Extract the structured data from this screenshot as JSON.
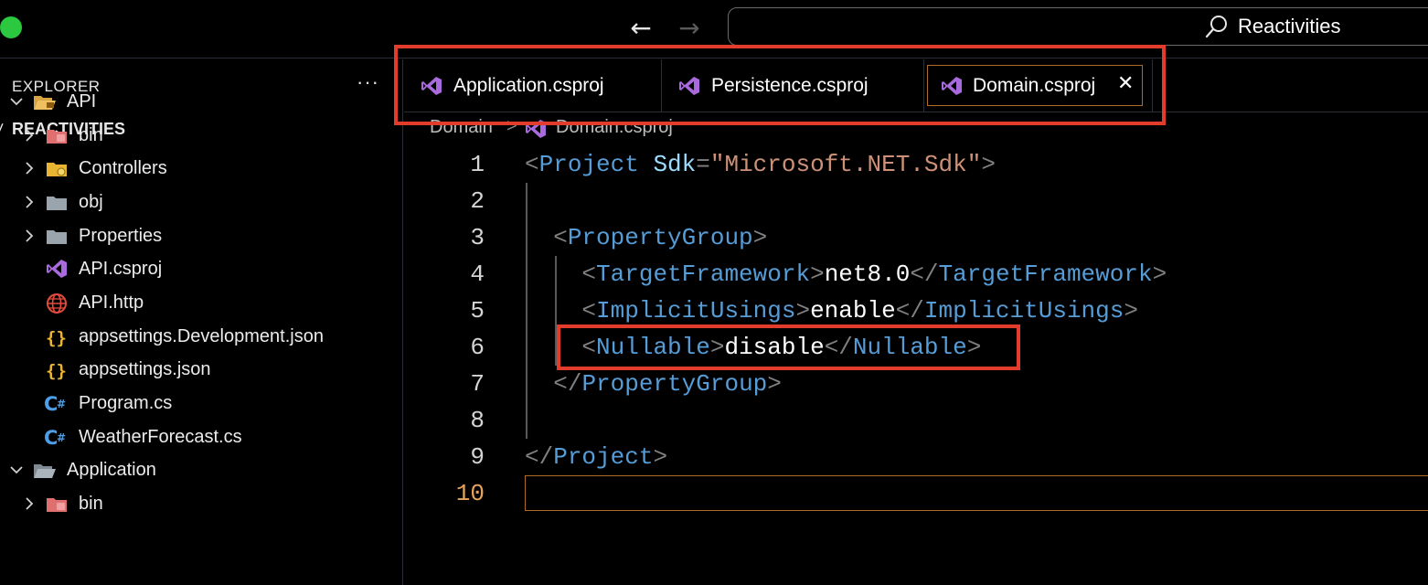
{
  "titlebar": {
    "back_icon": "arrow-left",
    "forward_icon": "arrow-right",
    "search_icon": "search-icon",
    "command_center_label": "Reactivities"
  },
  "sidebar": {
    "title": "EXPLORER",
    "more_label": "···",
    "workspace": "REACTIVITIES",
    "tree": [
      {
        "label": "API",
        "icon": "folder-api-open",
        "expanded": true
      },
      {
        "label": "bin",
        "icon": "folder-bin"
      },
      {
        "label": "Controllers",
        "icon": "folder-controllers"
      },
      {
        "label": "obj",
        "icon": "folder"
      },
      {
        "label": "Properties",
        "icon": "folder"
      },
      {
        "label": "API.csproj",
        "icon": "visual-studio-icon"
      },
      {
        "label": "API.http",
        "icon": "globe-icon"
      },
      {
        "label": "appsettings.Development.json",
        "icon": "json-braces-icon"
      },
      {
        "label": "appsettings.json",
        "icon": "json-braces-icon"
      },
      {
        "label": "Program.cs",
        "icon": "csharp-icon"
      },
      {
        "label": "WeatherForecast.cs",
        "icon": "csharp-icon"
      },
      {
        "label": "Application",
        "icon": "folder-open",
        "expanded": true
      },
      {
        "label": "bin",
        "icon": "folder-bin"
      }
    ]
  },
  "tabs": [
    {
      "label": "Application.csproj",
      "active": false
    },
    {
      "label": "Persistence.csproj",
      "active": false
    },
    {
      "label": "Domain.csproj",
      "active": true
    }
  ],
  "breadcrumb": {
    "folder": "Domain",
    "separator": ">",
    "file": "Domain.csproj"
  },
  "editor": {
    "current_line": 10,
    "lines": [
      {
        "n": "1",
        "tokens": [
          [
            "punct",
            "<"
          ],
          [
            "tag",
            "Project"
          ],
          [
            "text",
            " "
          ],
          [
            "attr",
            "Sdk"
          ],
          [
            "punct",
            "="
          ],
          [
            "str",
            "\"Microsoft.NET.Sdk\""
          ],
          [
            "punct",
            ">"
          ]
        ]
      },
      {
        "n": "2",
        "tokens": []
      },
      {
        "n": "3",
        "tokens": [
          [
            "text",
            "  "
          ],
          [
            "punct",
            "<"
          ],
          [
            "tag",
            "PropertyGroup"
          ],
          [
            "punct",
            ">"
          ]
        ]
      },
      {
        "n": "4",
        "tokens": [
          [
            "text",
            "    "
          ],
          [
            "punct",
            "<"
          ],
          [
            "tag",
            "TargetFramework"
          ],
          [
            "punct",
            ">"
          ],
          [
            "text",
            "net8.0"
          ],
          [
            "punct",
            "</"
          ],
          [
            "tag",
            "TargetFramework"
          ],
          [
            "punct",
            ">"
          ]
        ]
      },
      {
        "n": "5",
        "tokens": [
          [
            "text",
            "    "
          ],
          [
            "punct",
            "<"
          ],
          [
            "tag",
            "ImplicitUsings"
          ],
          [
            "punct",
            ">"
          ],
          [
            "text",
            "enable"
          ],
          [
            "punct",
            "</"
          ],
          [
            "tag",
            "ImplicitUsings"
          ],
          [
            "punct",
            ">"
          ]
        ]
      },
      {
        "n": "6",
        "tokens": [
          [
            "text",
            "    "
          ],
          [
            "punct",
            "<"
          ],
          [
            "tag",
            "Nullable"
          ],
          [
            "punct",
            ">"
          ],
          [
            "text",
            "disable"
          ],
          [
            "punct",
            "</"
          ],
          [
            "tag",
            "Nullable"
          ],
          [
            "punct",
            ">"
          ]
        ]
      },
      {
        "n": "7",
        "tokens": [
          [
            "text",
            "  "
          ],
          [
            "punct",
            "</"
          ],
          [
            "tag",
            "PropertyGroup"
          ],
          [
            "punct",
            ">"
          ]
        ]
      },
      {
        "n": "8",
        "tokens": []
      },
      {
        "n": "9",
        "tokens": [
          [
            "punct",
            "</"
          ],
          [
            "tag",
            "Project"
          ],
          [
            "punct",
            ">"
          ]
        ]
      },
      {
        "n": "10",
        "tokens": []
      }
    ]
  },
  "colors": {
    "annotation": "#e23c2c",
    "vs_purple": "#a86add",
    "tag": "#569cd6",
    "string": "#ce9178",
    "current_line_number": "#e5a45a"
  }
}
